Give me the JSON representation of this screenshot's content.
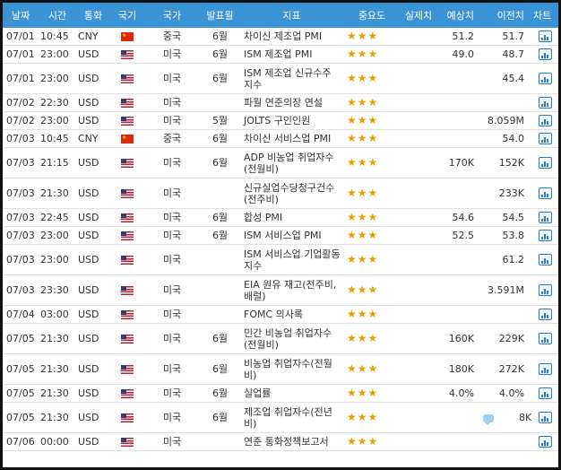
{
  "header": {
    "date": "날짜",
    "time": "시간",
    "currency": "통화",
    "flag": "국기",
    "country": "국가",
    "release_month": "발표월",
    "indicator": "지표",
    "importance": "중요도",
    "actual": "실제치",
    "forecast": "예상치",
    "previous": "이전치",
    "chart": "차트"
  },
  "colors": {
    "header_bg": "#3a93d4",
    "star": "#e6a000",
    "icon": "#2a7dc4"
  },
  "importance_stars": "★★★",
  "rows": [
    {
      "date": "07/01",
      "time": "10:45",
      "currency": "CNY",
      "flag": "cn-flag-icon",
      "country": "중국",
      "month": "6월",
      "indicator": "차이신 제조업 PMI",
      "actual": "",
      "forecast": "51.2",
      "previous": "51.7"
    },
    {
      "date": "07/01",
      "time": "23:00",
      "currency": "USD",
      "flag": "us-flag-icon",
      "country": "미국",
      "month": "6월",
      "indicator": "ISM 제조업 PMI",
      "actual": "",
      "forecast": "49.0",
      "previous": "48.7"
    },
    {
      "date": "07/01",
      "time": "23:00",
      "currency": "USD",
      "flag": "us-flag-icon",
      "country": "미국",
      "month": "6월",
      "indicator": "ISM 제조업 신규수주 지수",
      "actual": "",
      "forecast": "",
      "previous": "45.4"
    },
    {
      "date": "07/02",
      "time": "22:30",
      "currency": "USD",
      "flag": "us-flag-icon",
      "country": "미국",
      "month": "",
      "indicator": "파월 연준의장 연설",
      "actual": "",
      "forecast": "",
      "previous": ""
    },
    {
      "date": "07/02",
      "time": "23:00",
      "currency": "USD",
      "flag": "us-flag-icon",
      "country": "미국",
      "month": "5월",
      "indicator": "JOLTS 구인인원",
      "actual": "",
      "forecast": "",
      "previous": "8.059M"
    },
    {
      "date": "07/03",
      "time": "10:45",
      "currency": "CNY",
      "flag": "cn-flag-icon",
      "country": "중국",
      "month": "6월",
      "indicator": "차이신 서비스업 PMI",
      "actual": "",
      "forecast": "",
      "previous": "54.0"
    },
    {
      "date": "07/03",
      "time": "21:15",
      "currency": "USD",
      "flag": "us-flag-icon",
      "country": "미국",
      "month": "6월",
      "indicator": "ADP 비농업 취업자수 (전월비)",
      "actual": "",
      "forecast": "170K",
      "previous": "152K"
    },
    {
      "date": "07/03",
      "time": "21:30",
      "currency": "USD",
      "flag": "us-flag-icon",
      "country": "미국",
      "month": "",
      "indicator": "신규실업수당청구건수 (전주비)",
      "actual": "",
      "forecast": "",
      "previous": "233K"
    },
    {
      "date": "07/03",
      "time": "22:45",
      "currency": "USD",
      "flag": "us-flag-icon",
      "country": "미국",
      "month": "6월",
      "indicator": "합성 PMI",
      "actual": "",
      "forecast": "54.6",
      "previous": "54.5"
    },
    {
      "date": "07/03",
      "time": "23:00",
      "currency": "USD",
      "flag": "us-flag-icon",
      "country": "미국",
      "month": "6월",
      "indicator": "ISM 서비스업 PMI",
      "actual": "",
      "forecast": "52.5",
      "previous": "53.8"
    },
    {
      "date": "07/03",
      "time": "23:00",
      "currency": "USD",
      "flag": "us-flag-icon",
      "country": "미국",
      "month": "",
      "indicator": "ISM 서비스업 기업활동지수",
      "actual": "",
      "forecast": "",
      "previous": "61.2"
    },
    {
      "date": "07/03",
      "time": "23:30",
      "currency": "USD",
      "flag": "us-flag-icon",
      "country": "미국",
      "month": "",
      "indicator": "EIA 원유 재고(전주비, 배럴)",
      "actual": "",
      "forecast": "",
      "previous": "3.591M"
    },
    {
      "date": "07/04",
      "time": "03:00",
      "currency": "USD",
      "flag": "us-flag-icon",
      "country": "미국",
      "month": "",
      "indicator": "FOMC 의사록",
      "actual": "",
      "forecast": "",
      "previous": ""
    },
    {
      "date": "07/05",
      "time": "21:30",
      "currency": "USD",
      "flag": "us-flag-icon",
      "country": "미국",
      "month": "6월",
      "indicator": "민간 비농업 취업자수 (전월비)",
      "actual": "",
      "forecast": "160K",
      "previous": "229K"
    },
    {
      "date": "07/05",
      "time": "21:30",
      "currency": "USD",
      "flag": "us-flag-icon",
      "country": "미국",
      "month": "6월",
      "indicator": "비농업 취업자수(전월비)",
      "actual": "",
      "forecast": "180K",
      "previous": "272K"
    },
    {
      "date": "07/05",
      "time": "21:30",
      "currency": "USD",
      "flag": "us-flag-icon",
      "country": "미국",
      "month": "6월",
      "indicator": "실업률",
      "actual": "",
      "forecast": "4.0%",
      "previous": "4.0%"
    },
    {
      "date": "07/05",
      "time": "21:30",
      "currency": "USD",
      "flag": "us-flag-icon",
      "country": "미국",
      "month": "6월",
      "indicator": "제조업 취업자수(전년비)",
      "actual": "",
      "forecast": "",
      "previous": "8K",
      "comment": "chat-bubble-icon"
    },
    {
      "date": "07/06",
      "time": "00:00",
      "currency": "USD",
      "flag": "us-flag-icon",
      "country": "미국",
      "month": "",
      "indicator": "연준 통화정책보고서",
      "actual": "",
      "forecast": "",
      "previous": ""
    }
  ]
}
